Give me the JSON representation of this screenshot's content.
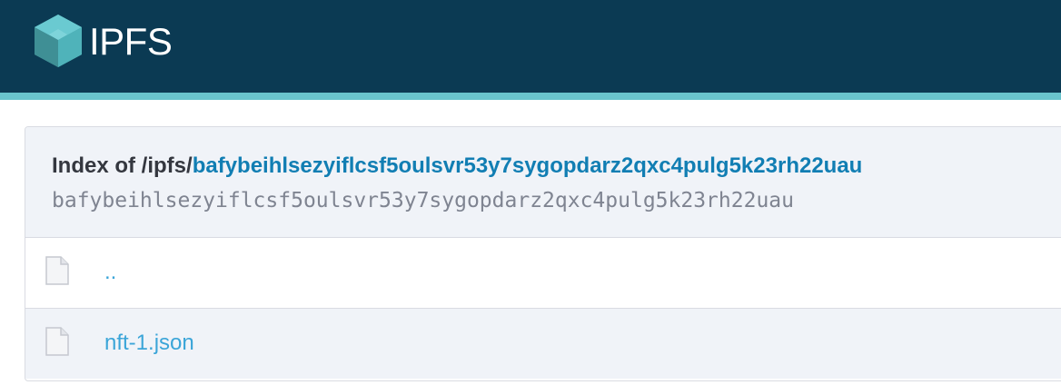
{
  "header": {
    "brand": "IPFS",
    "logo_icon": "ipfs-cube-icon",
    "background_color": "#0b3a53",
    "stripe_color": "#69c4cd"
  },
  "index": {
    "prefix": "Index of /ipfs/",
    "cid_link": "bafybeihlsezyiflcsf5oulsvr53y7sygopdarz2qxc4pulg5k23rh22uau",
    "cid": "bafybeihlsezyiflcsf5oulsvr53y7sygopdarz2qxc4pulg5k23rh22uau"
  },
  "files": [
    {
      "name": "..",
      "icon": "file-icon"
    },
    {
      "name": "nft-1.json",
      "icon": "file-icon"
    }
  ],
  "colors": {
    "link": "#3ba5d8",
    "title_link": "#117eb3",
    "panel_bg": "#f0f3f8"
  }
}
